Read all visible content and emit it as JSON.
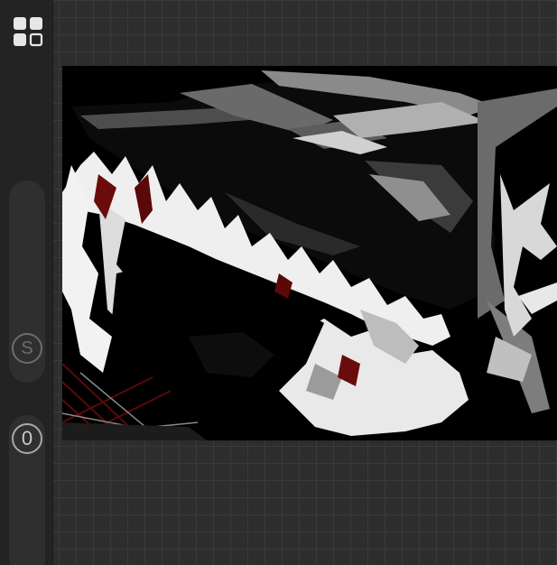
{
  "sidebar": {
    "menu_icon": "grid-menu-icon",
    "brush_size": {
      "label": "S",
      "icon": "size-slider-knob-icon"
    },
    "brush_opacity": {
      "label": "0",
      "icon": "opacity-slider-knob-icon"
    }
  },
  "workspace": {
    "canvas": {
      "artwork": "ink-brush-drawing"
    }
  },
  "colors": {
    "background": "#2b2b2b",
    "sidebar": "#232323",
    "grid_line": "#3a3a3a",
    "canvas": "#000000",
    "accent_red": "#6a0c0c"
  }
}
